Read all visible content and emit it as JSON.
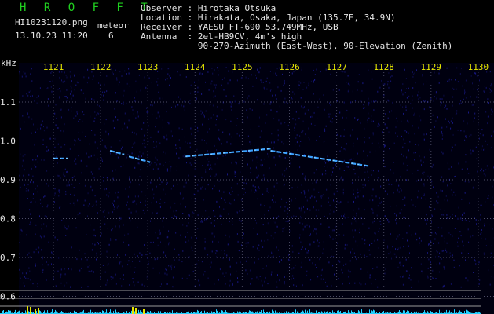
{
  "header": {
    "brand": "H R O F F T",
    "filename": "HI10231120.png",
    "timestamp": "13.10.23 11:20",
    "meteor_label": "meteor",
    "meteor_count": "6",
    "observer": "Observer : Hirotaka Otsuka",
    "location": "Location : Hirakata, Osaka, Japan (135.7E, 34.9N)",
    "receiver": "Receiver : YAESU FT-690 53.749MHz, USB",
    "antenna": "Antenna  : 2el-HB9CV, 4m's high",
    "antenna2": "           90-270-Azimuth (East-West), 90-Elevation (Zenith)"
  },
  "chart_data": {
    "type": "heatmap",
    "title": "",
    "xlabel": "",
    "ylabel": "kHz",
    "x_tick_labels": [
      "1121",
      "1122",
      "1123",
      "1124",
      "1125",
      "1126",
      "1127",
      "1128",
      "1129",
      "1130"
    ],
    "y_tick_labels": [
      "1.1",
      "1.0",
      "0.9",
      "0.8",
      "0.7",
      "0.6"
    ],
    "y_ticks": [
      1.1,
      1.0,
      0.9,
      0.8,
      0.7,
      0.6
    ],
    "ylim": [
      0.58,
      1.2
    ],
    "colors": {
      "background": "#000010",
      "noise": "#1a1a8c",
      "trace": "#3aa0ff",
      "trace_hot": "#9fe0ff",
      "grid": "#8080a0",
      "level": "#22d0ff",
      "level_peak": "#e8e800",
      "text": "#e6e6e6",
      "ticks_label": "#e8e800"
    },
    "traces": [
      {
        "name": "",
        "x": [
          1121.0,
          1121.3
        ],
        "y": [
          0.955,
          0.955
        ]
      },
      {
        "name": "",
        "x": [
          1122.2,
          1122.5
        ],
        "y": [
          0.975,
          0.965
        ]
      },
      {
        "name": "",
        "x": [
          1122.6,
          1123.05
        ],
        "y": [
          0.96,
          0.945
        ]
      },
      {
        "name": "",
        "x": [
          1123.8,
          1125.6
        ],
        "y": [
          0.96,
          0.98
        ]
      },
      {
        "name": "",
        "x": [
          1125.6,
          1127.7
        ],
        "y": [
          0.975,
          0.935
        ]
      }
    ]
  }
}
